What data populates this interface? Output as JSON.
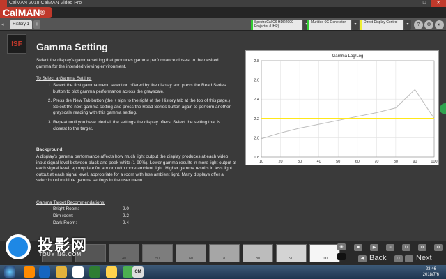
{
  "window": {
    "title": "CalMAN 2018 CalMAN Video Pro",
    "min": "–",
    "max": "□",
    "close": "✕"
  },
  "brand": {
    "name": "CalMAN",
    "mark": "®"
  },
  "tabs": {
    "history": "History 1",
    "add": "+"
  },
  "devices": [
    {
      "line1": "SpectraCal C6 HDR2000",
      "line2": "Projector (UHP)"
    },
    {
      "line1": "Murideo 6G Generator",
      "line2": ""
    },
    {
      "line1": "Direct Display Control",
      "line2": ""
    }
  ],
  "page": {
    "title": "Gamma Setting",
    "intro": "Select the display's gamma setting that produces gamma performance closest to the desired gamma for the intended viewing environment.",
    "how_to": "To Select a Gamma Setting:",
    "step1": "Select the first gamma menu selection offered by the display and press the Read Series button to plot gamma performance across the grayscale.",
    "step2": "Press the New Tab button (the + sign to the right of the History tab at the top of this page.) Select the next gamma setting and press the Read Series button again to perform another grayscale reading with this gamma setting.",
    "step3": "Repeat until you have tried all the settings the display offers. Select the setting that is closest to the target.",
    "background_title": "Background:",
    "background": "A display's gamma performance affects how much light output the display produces at each video input signal level between black and peak white (1-99%). Lower gamma results in more light output at each signal level, appropriate for a room with more ambient light. Higher gamma results in less light output at each signal level, appropriate for a room with less ambient light. Many displays offer a selection of multiple gamma settings in the user menu.",
    "targets_title": "Gamma Target Recommendations:",
    "targets": [
      {
        "room": "Bright Room:",
        "value": "2.0"
      },
      {
        "room": "Dim room:",
        "value": "2.2"
      },
      {
        "room": "Dark Room:",
        "value": "2.4"
      }
    ]
  },
  "chart_data": {
    "type": "line",
    "title": "Gamma Log/Log",
    "x": [
      10,
      20,
      30,
      40,
      50,
      60,
      70,
      80,
      90,
      100
    ],
    "xlim": [
      10,
      100
    ],
    "ylim": [
      1.8,
      2.8
    ],
    "yticks": [
      1.8,
      2.0,
      2.2,
      2.4,
      2.6,
      2.8
    ],
    "series": [
      {
        "values": [
          1.99,
          2.05,
          2.1,
          2.14,
          2.18,
          2.22,
          2.26,
          2.31,
          2.5,
          2.2
        ],
        "color": "#bdbdbd"
      },
      {
        "values": [
          2.2,
          2.2,
          2.2,
          2.2,
          2.2,
          2.2,
          2.2,
          2.2,
          2.2,
          2.2
        ],
        "color": "#ffe81a"
      }
    ]
  },
  "patches": [
    {
      "label": "40",
      "color": "#6a6a6a"
    },
    {
      "label": "50",
      "color": "#7d7d7d"
    },
    {
      "label": "60",
      "color": "#919191"
    },
    {
      "label": "70",
      "color": "#a6a6a6"
    },
    {
      "label": "80",
      "color": "#bcbcbc"
    },
    {
      "label": "90",
      "color": "#d4d4d4"
    },
    {
      "label": "100",
      "color": "#f6f6f6"
    }
  ],
  "nav": {
    "back": "Back",
    "next": "Next"
  },
  "watermark": {
    "main": "投影网",
    "sub": "TOUYING.COM"
  },
  "clock": {
    "time": "23:46",
    "date": "2018/7/6"
  }
}
